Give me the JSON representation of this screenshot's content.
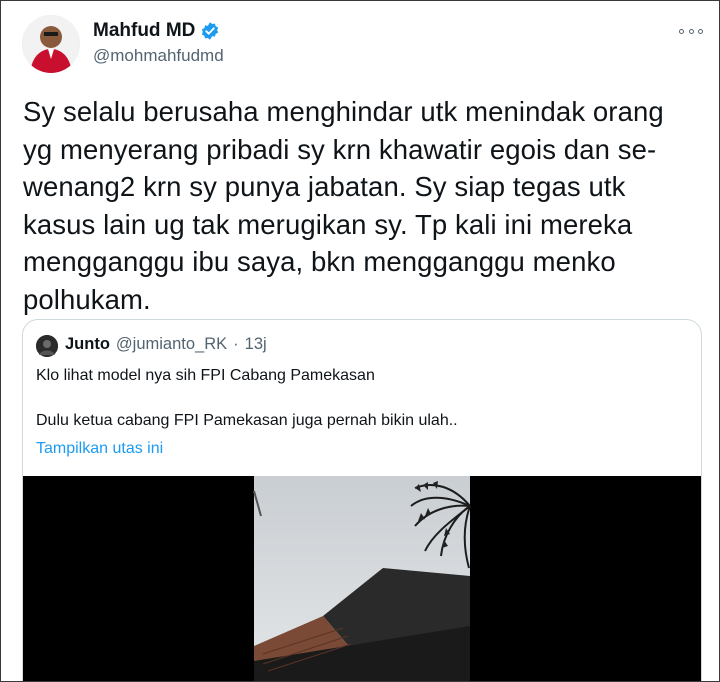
{
  "tweet": {
    "author_name": "Mahfud MD",
    "author_handle": "@mohmahfudmd",
    "text": "Sy selalu berusaha menghindar utk menindak orang yg menyerang pribadi sy krn khawatir egois dan se-wenang2 krn sy punya jabatan. Sy siap tegas utk kasus lain ug tak merugikan sy. Tp kali ini mereka mengganggu ibu saya, bkn mengganggu menko polhukam.",
    "icons": {
      "verified": "verified-badge-icon",
      "more": "more-options-icon"
    }
  },
  "quote": {
    "author_name": "Junto",
    "author_handle": "@jumianto_RK",
    "separator": "·",
    "time": "13j",
    "line1": "Klo lihat model nya sih FPI Cabang Pamekasan",
    "line2": "Dulu ketua cabang FPI Pamekasan juga pernah bikin ulah..",
    "show_thread": "Tampilkan utas ini"
  },
  "colors": {
    "accent": "#1d9bf0",
    "text": "#0f1419",
    "secondary": "#536471",
    "border": "#cfd9de"
  }
}
